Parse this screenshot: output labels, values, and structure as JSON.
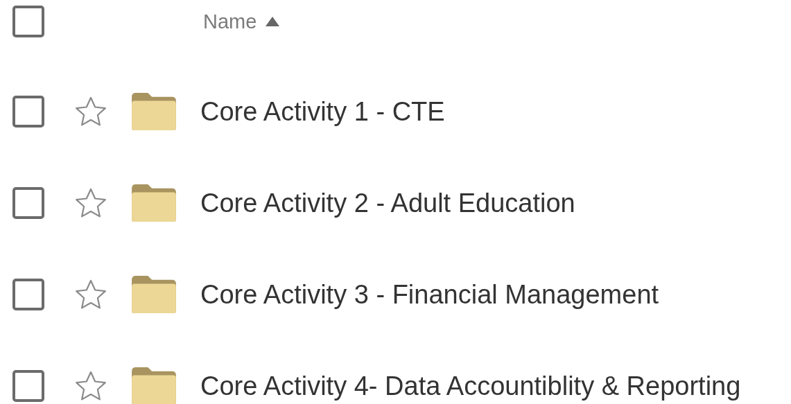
{
  "header": {
    "select_all_checked": false,
    "column": "Name",
    "sorted_ascending": true
  },
  "rows": [
    {
      "name": "Core Activity 1 - CTE",
      "checked": false,
      "starred": false
    },
    {
      "name": "Core Activity 2 - Adult Education",
      "checked": false,
      "starred": false
    },
    {
      "name": "Core Activity 3 - Financial Management",
      "checked": false,
      "starred": false
    },
    {
      "name": "Core Activity 4- Data Accountiblity & Reporting",
      "checked": false,
      "starred": false
    }
  ]
}
